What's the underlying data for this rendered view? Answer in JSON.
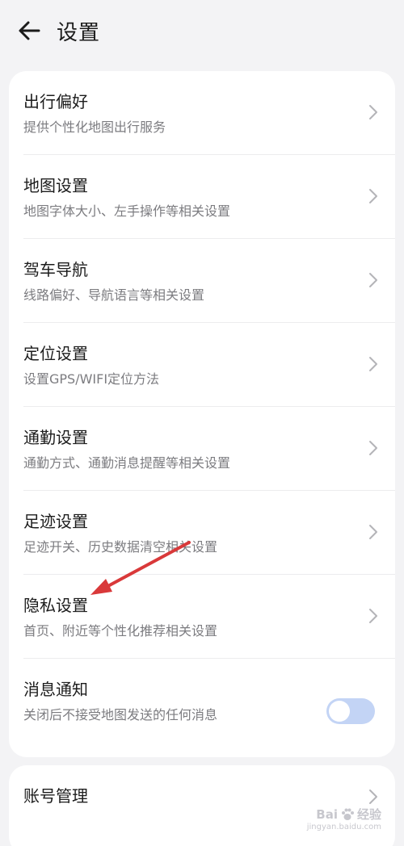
{
  "header": {
    "title": "设置",
    "back_icon": "arrow-left-icon"
  },
  "settings": [
    {
      "title": "出行偏好",
      "subtitle": "提供个性化地图出行服务",
      "control": "chevron"
    },
    {
      "title": "地图设置",
      "subtitle": "地图字体大小、左手操作等相关设置",
      "control": "chevron"
    },
    {
      "title": "驾车导航",
      "subtitle": "线路偏好、导航语言等相关设置",
      "control": "chevron"
    },
    {
      "title": "定位设置",
      "subtitle": "设置GPS/WIFI定位方法",
      "control": "chevron"
    },
    {
      "title": "通勤设置",
      "subtitle": "通勤方式、通勤消息提醒等相关设置",
      "control": "chevron"
    },
    {
      "title": "足迹设置",
      "subtitle": "足迹开关、历史数据清空相关设置",
      "control": "chevron"
    },
    {
      "title": "隐私设置",
      "subtitle": "首页、附近等个性化推荐相关设置",
      "control": "chevron"
    },
    {
      "title": "消息通知",
      "subtitle": "关闭后不接受地图发送的任何消息",
      "control": "toggle",
      "toggle_on": false
    }
  ],
  "account": {
    "title": "账号管理",
    "control": "chevron"
  },
  "annotation": {
    "arrow_color": "#d9393a",
    "target": "隐私设置"
  },
  "watermark": {
    "brand_left": "Bai",
    "brand_right": "经验",
    "subtitle": "jingyan.baidu.com"
  },
  "colors": {
    "background": "#f3f3f5",
    "card": "#ffffff",
    "toggle_off": "#c3d4f5"
  }
}
